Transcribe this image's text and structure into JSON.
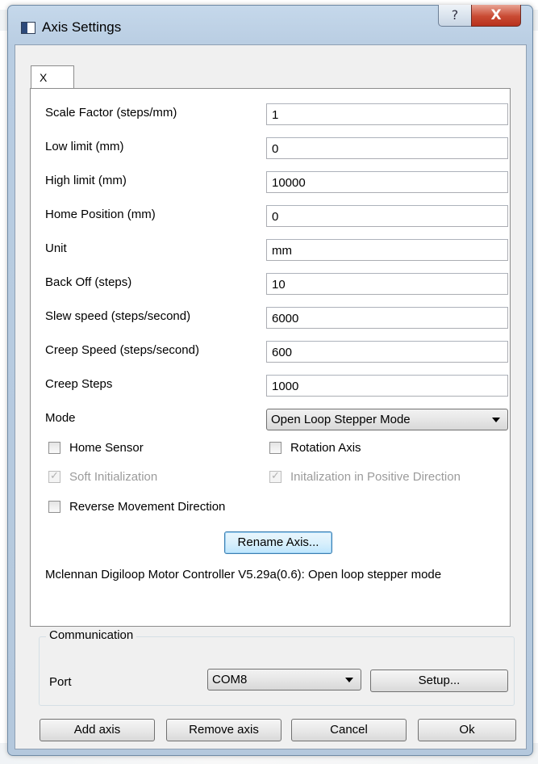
{
  "window": {
    "title": "Axis Settings",
    "help_symbol": "?",
    "close_symbol": "X"
  },
  "tabs": [
    {
      "label": "X",
      "selected": true
    }
  ],
  "fields": [
    {
      "label": "Scale Factor (steps/mm)",
      "value": "1"
    },
    {
      "label": "Low limit (mm)",
      "value": "0"
    },
    {
      "label": "High limit (mm)",
      "value": "10000"
    },
    {
      "label": "Home Position (mm)",
      "value": "0"
    },
    {
      "label": "Unit",
      "value": "mm"
    },
    {
      "label": "Back Off (steps)",
      "value": "10"
    },
    {
      "label": "Slew speed (steps/second)",
      "value": "6000"
    },
    {
      "label": "Creep Speed (steps/second)",
      "value": "600"
    },
    {
      "label": "Creep Steps",
      "value": "1000"
    }
  ],
  "mode": {
    "label": "Mode",
    "value": "Open Loop Stepper Mode"
  },
  "checkboxes": {
    "home_sensor": {
      "label": "Home Sensor",
      "checked": false,
      "enabled": true
    },
    "rotation_axis": {
      "label": "Rotation Axis",
      "checked": false,
      "enabled": true
    },
    "soft_init": {
      "label": "Soft Initialization",
      "checked": true,
      "enabled": false
    },
    "init_positive": {
      "label": "Initalization in Positive Direction",
      "checked": true,
      "enabled": false
    },
    "reverse": {
      "label": "Reverse Movement Direction",
      "checked": false,
      "enabled": true
    }
  },
  "rename_button": "Rename Axis...",
  "status": "Mclennan Digiloop Motor Controller V5.29a(0.6): Open loop stepper mode",
  "communication": {
    "title": "Communication",
    "port_label": "Port",
    "port_value": "COM8",
    "setup_button": "Setup..."
  },
  "footer": {
    "add_axis": "Add axis",
    "remove_axis": "Remove axis",
    "cancel": "Cancel",
    "ok": "Ok"
  },
  "colors": {
    "frame": "#b9cde2",
    "close_button": "#c94a33",
    "focused_button": "#3c7fb1"
  }
}
